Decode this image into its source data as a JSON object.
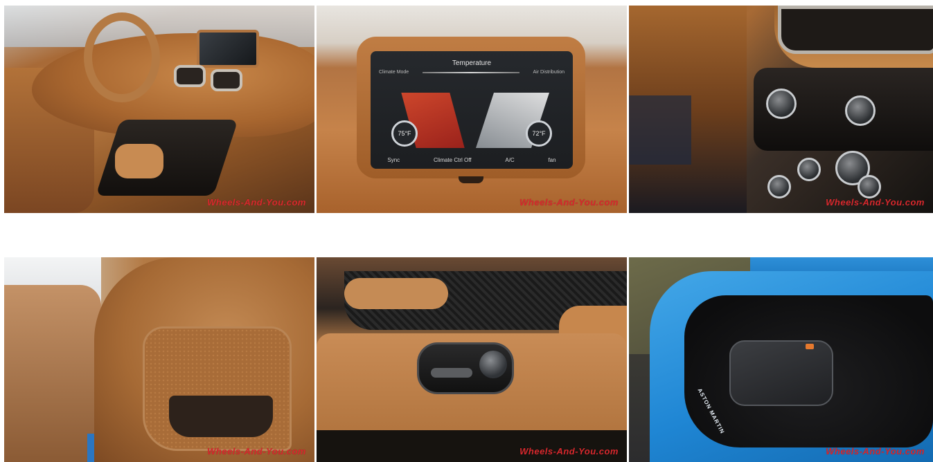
{
  "gallery": {
    "watermark": "Wheels-And-You.com",
    "photos": [
      {
        "subject": "dashboard"
      },
      {
        "subject": "infotainment",
        "screen": {
          "title": "Temperature",
          "left_label": "Climate Mode",
          "right_label": "Air Distribution",
          "temp_left": "75°F",
          "temp_right": "72°F",
          "bottom": [
            "Sync",
            "Climate Ctrl Off",
            "A/C",
            "fan"
          ]
        }
      },
      {
        "subject": "center-console"
      },
      {
        "subject": "seat-back"
      },
      {
        "subject": "seat-controls"
      },
      {
        "subject": "trunk",
        "badge": "ASTON MARTIN"
      }
    ]
  },
  "colors": {
    "watermark": "#d8282d",
    "leather": "#b4773f",
    "body_blue": "#1f86d4"
  }
}
